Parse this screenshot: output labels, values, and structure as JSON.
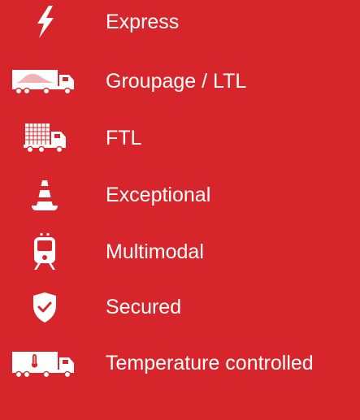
{
  "accent_color": "#d7262b",
  "text_color": "#ffffff",
  "items": [
    {
      "label": "Express",
      "icon": "lightning-bolt-icon"
    },
    {
      "label": "Groupage / LTL",
      "icon": "groupage-truck-icon"
    },
    {
      "label": "FTL",
      "icon": "full-truck-icon"
    },
    {
      "label": "Exceptional",
      "icon": "traffic-cone-icon"
    },
    {
      "label": "Multimodal",
      "icon": "train-icon"
    },
    {
      "label": "Secured",
      "icon": "shield-check-icon"
    },
    {
      "label": "Temperature controlled",
      "icon": "refrigerated-truck-icon"
    }
  ]
}
